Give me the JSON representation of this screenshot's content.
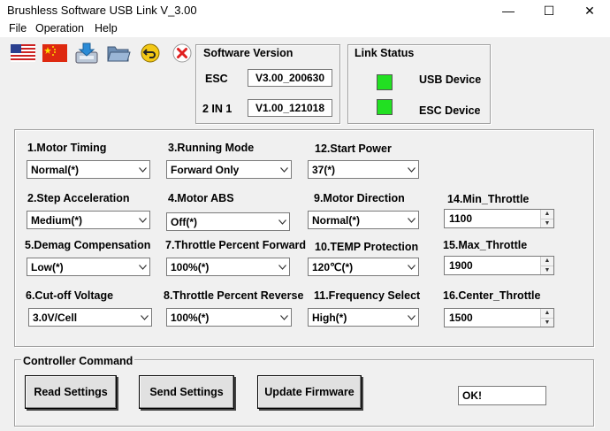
{
  "window": {
    "title": "Brushless Software USB Link V_3.00",
    "controls": [
      "—",
      "☐",
      "✕"
    ]
  },
  "menu": [
    "File",
    "Operation",
    "Help"
  ],
  "toolbar": [
    "us-flag-icon",
    "china-flag-icon",
    "download-icon",
    "folder-open-icon",
    "undo-icon",
    "close-icon"
  ],
  "software_version": {
    "title": "Software Version",
    "rows": [
      {
        "label": "ESC",
        "value": "V3.00_200630"
      },
      {
        "label": "2 IN 1",
        "value": "V1.00_121018"
      }
    ]
  },
  "link_status": {
    "title": "Link Status",
    "colors": {
      "on": "#22e022"
    },
    "rows": [
      {
        "label": "USB Device"
      },
      {
        "label": "ESC Device"
      }
    ]
  },
  "settings": {
    "motor_timing": {
      "label": "1.Motor Timing",
      "value": "Normal(*)"
    },
    "step_acceleration": {
      "label": "2.Step Acceleration",
      "value": "Medium(*)"
    },
    "running_mode": {
      "label": "3.Running Mode",
      "value": "Forward Only"
    },
    "motor_abs": {
      "label": "4.Motor ABS",
      "value": "Off(*)"
    },
    "demag_compensation": {
      "label": "5.Demag Compensation",
      "value": "Low(*)"
    },
    "cutoff_voltage": {
      "label": "6.Cut-off Voltage",
      "value": "3.0V/Cell"
    },
    "throttle_forward": {
      "label": "7.Throttle Percent Forward",
      "value": "100%(*)"
    },
    "throttle_reverse": {
      "label": "8.Throttle Percent Reverse",
      "value": "100%(*)"
    },
    "motor_direction": {
      "label": "9.Motor Direction",
      "value": "Normal(*)"
    },
    "temp_protection": {
      "label": "10.TEMP Protection",
      "value": "120℃(*)"
    },
    "frequency_select": {
      "label": "11.Frequency Select",
      "value": "High(*)"
    },
    "start_power": {
      "label": "12.Start Power",
      "value": "37(*)"
    },
    "min_throttle": {
      "label": "14.Min_Throttle",
      "value": "1100"
    },
    "max_throttle": {
      "label": "15.Max_Throttle",
      "value": "1900"
    },
    "center_throttle": {
      "label": "16.Center_Throttle",
      "value": "1500"
    }
  },
  "controller": {
    "title": "Controller Command",
    "read": "Read Settings",
    "send": "Send Settings",
    "update": "Update Firmware",
    "status": "OK!"
  }
}
